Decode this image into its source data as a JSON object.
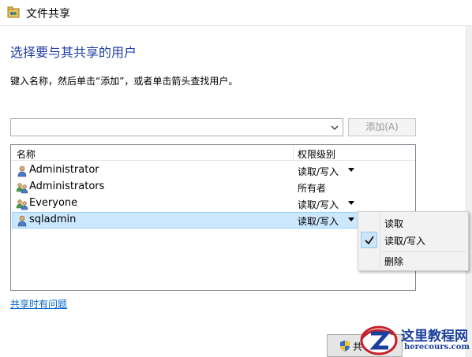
{
  "window": {
    "title": "文件共享"
  },
  "heading": "选择要与其共享的用户",
  "instruction": "键入名称，然后单击“添加”，或者单击箭头查找用户。",
  "name_input": {
    "value": "",
    "placeholder": ""
  },
  "add_button": {
    "label": "添加(A)"
  },
  "list": {
    "columns": [
      "名称",
      "权限级别"
    ],
    "rows": [
      {
        "name": "Administrator",
        "permission": "读取/写入",
        "icon": "user-icon",
        "has_dropdown": true
      },
      {
        "name": "Administrators",
        "permission": "所有者",
        "icon": "group-icon",
        "has_dropdown": false
      },
      {
        "name": "Everyone",
        "permission": "读取/写入",
        "icon": "group-icon",
        "has_dropdown": true
      },
      {
        "name": "sqladmin",
        "permission": "读取/写入",
        "icon": "user-icon",
        "has_dropdown": true,
        "selected": true
      }
    ]
  },
  "context_menu": {
    "items": [
      {
        "label": "读取",
        "checked": false
      },
      {
        "label": "读取/写入",
        "checked": true
      },
      {
        "label": "删除",
        "checked": false
      }
    ]
  },
  "help_link": "共享时有问题",
  "share_button": {
    "label": "共"
  },
  "watermark": {
    "line1": "这里教程网",
    "line2": "herecours.com"
  },
  "colors": {
    "heading": "#1f3f9f",
    "link": "#0066cc",
    "selection": "#cce8ff"
  }
}
